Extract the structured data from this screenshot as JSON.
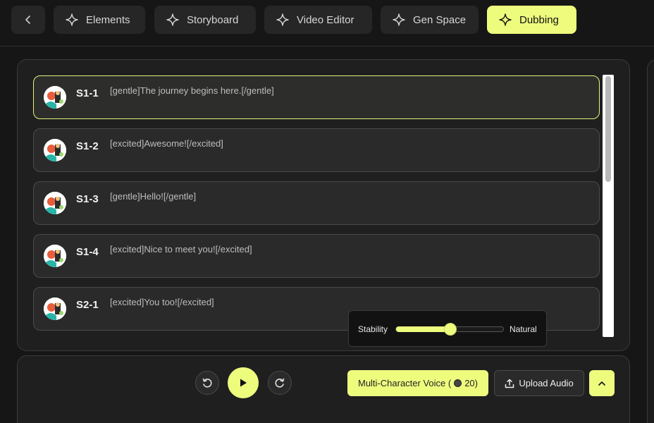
{
  "nav": {
    "tabs": [
      {
        "label": "Elements"
      },
      {
        "label": "Storyboard"
      },
      {
        "label": "Video Editor"
      },
      {
        "label": "Gen Space"
      },
      {
        "label": "Dubbing"
      }
    ],
    "active_tab": "Dubbing"
  },
  "lines": [
    {
      "id": "S1-1",
      "text": "[gentle]The journey begins here.[/gentle]"
    },
    {
      "id": "S1-2",
      "text": "[excited]Awesome![/excited]"
    },
    {
      "id": "S1-3",
      "text": "[gentle]Hello![/gentle]"
    },
    {
      "id": "S1-4",
      "text": "[excited]Nice to meet you![/excited]"
    },
    {
      "id": "S2-1",
      "text": "[excited]You too![/excited]"
    }
  ],
  "stability": {
    "left_label": "Stability",
    "right_label": "Natural",
    "value": 0.5
  },
  "controls": {
    "voice_label": "Multi-Character Voice (",
    "voice_cost": "20)",
    "upload_label": "Upload Audio"
  },
  "colors": {
    "accent": "#eefc7e",
    "background": "#161616",
    "panel": "#1f1f1f"
  }
}
